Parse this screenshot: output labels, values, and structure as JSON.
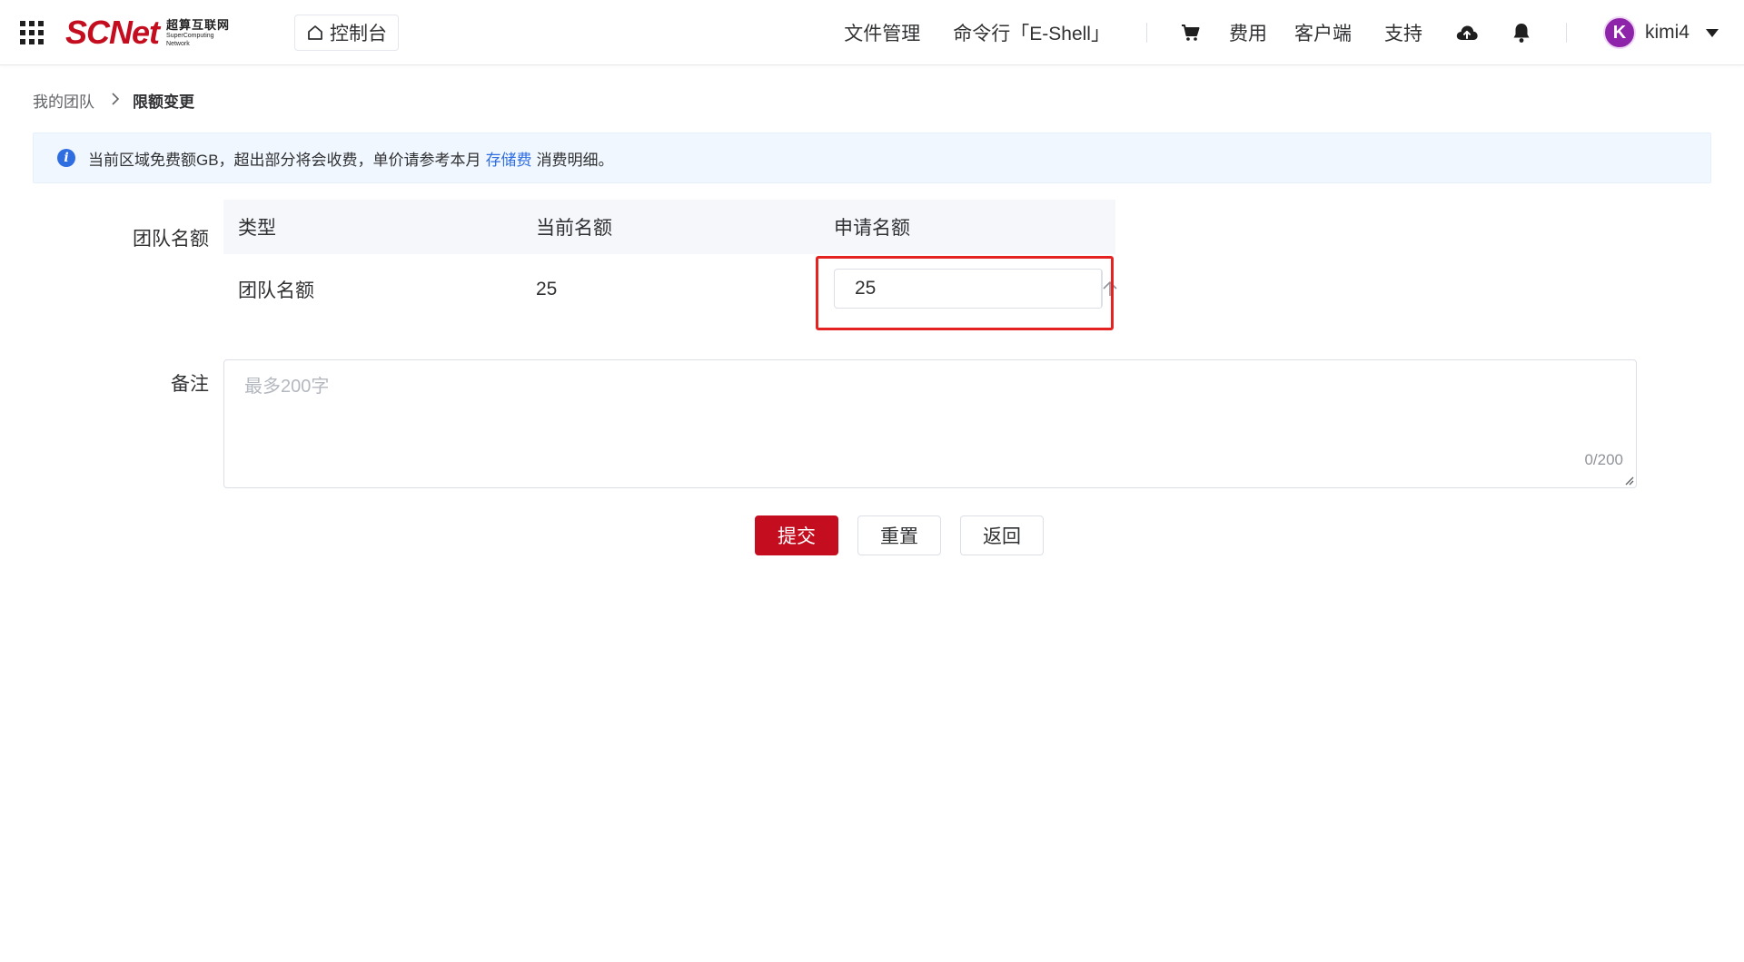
{
  "header": {
    "logo_text": "SCNet",
    "logo_cn": "超算互联网",
    "logo_en_1": "SuperComputing",
    "logo_en_2": "Network",
    "console_label": "控制台",
    "nav": {
      "file_manage": "文件管理",
      "eshell": "命令行「E-Shell」",
      "fees": "费用",
      "client": "客户端",
      "support": "支持"
    },
    "user": {
      "avatar_letter": "K",
      "name": "kimi4"
    }
  },
  "breadcrumb": {
    "parent": "我的团队",
    "current": "限额变更"
  },
  "alert": {
    "text_before": "当前区域免费额GB，超出部分将会收费，单价请参考本月",
    "link": "存储费",
    "text_after": "消费明细。"
  },
  "form": {
    "team_quota_label": "团队名额",
    "table": {
      "headers": [
        "类型",
        "当前名额",
        "申请名额"
      ],
      "row": {
        "type": "团队名额",
        "current": "25",
        "requested": "25"
      }
    },
    "remark_label": "备注",
    "remark_placeholder": "最多200字",
    "remark_value": "",
    "remark_count": "0/200"
  },
  "buttons": {
    "submit": "提交",
    "reset": "重置",
    "back": "返回"
  },
  "colors": {
    "brand": "#c40d1e",
    "link": "#2f6ee0",
    "highlight": "#e52222",
    "alert_bg": "#f0f7ff"
  }
}
